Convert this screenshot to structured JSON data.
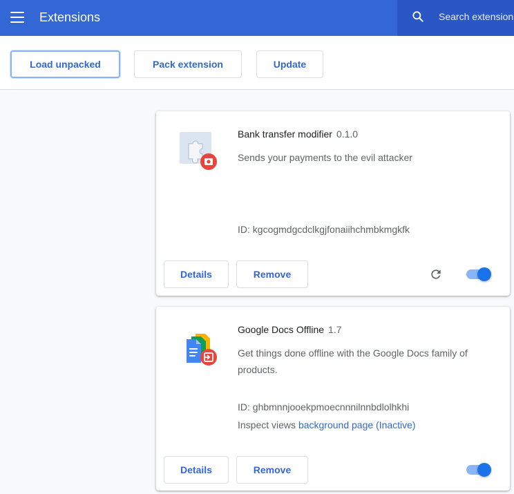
{
  "header": {
    "title": "Extensions",
    "search_placeholder": "Search extensions"
  },
  "toolbar": {
    "load_unpacked": "Load unpacked",
    "pack_extension": "Pack extension",
    "update": "Update"
  },
  "extensions": [
    {
      "name": "Bank transfer modifier",
      "version": "0.1.0",
      "description": "Sends your payments to the evil attacker",
      "id_text": "ID: kgcogmdgcdclkgjfonaiihchmbkmgkfk",
      "details_label": "Details",
      "remove_label": "Remove",
      "enabled": true
    },
    {
      "name": "Google Docs Offline",
      "version": "1.7",
      "description": "Get things done offline with the Google Docs family of products.",
      "id_text": "ID: ghbmnnjooekpmoecnnnilnnbdlolhkhi",
      "inspect_label": "Inspect views",
      "inspect_link": "background page (Inactive)",
      "details_label": "Details",
      "remove_label": "Remove",
      "enabled": true
    }
  ],
  "colors": {
    "header_bg": "#3367d6",
    "accent": "#3367d6",
    "toggle_on": "#1a73e8",
    "badge": "#e8453c"
  },
  "icons": {
    "menu": "hamburger-menu-icon",
    "search": "search-icon",
    "reload": "reload-icon",
    "ext1": "puzzle-piece-icon",
    "ext2": "google-docs-icon"
  }
}
